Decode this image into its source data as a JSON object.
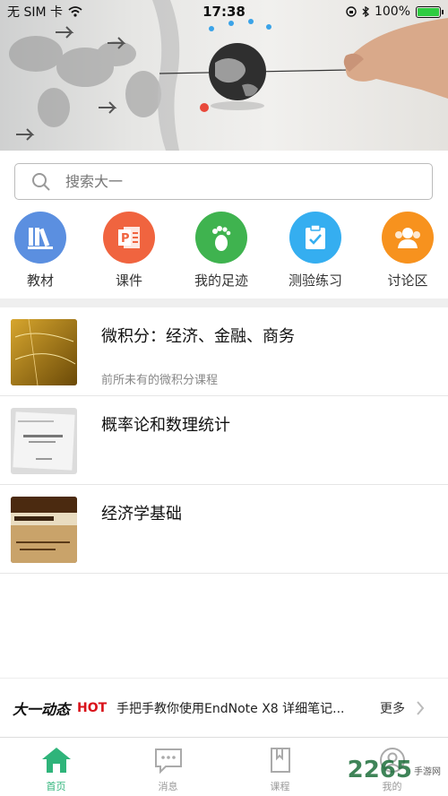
{
  "status_bar": {
    "carrier": "无 SIM 卡",
    "time": "17:38",
    "battery": "100%",
    "battery_level": 1.0
  },
  "search": {
    "placeholder": "搜索大一"
  },
  "quick_nav": [
    {
      "label": "教材",
      "icon": "books-icon",
      "color": "#5b8fe0"
    },
    {
      "label": "课件",
      "icon": "powerpoint-icon",
      "color": "#f0643f"
    },
    {
      "label": "我的足迹",
      "icon": "footprint-icon",
      "color": "#3fb34f"
    },
    {
      "label": "测验练习",
      "icon": "clipboard-check-icon",
      "color": "#35aef0"
    },
    {
      "label": "讨论区",
      "icon": "group-icon",
      "color": "#f7921e"
    }
  ],
  "courses": [
    {
      "title": "微积分：经济、金融、商务",
      "desc": "前所未有的微积分课程"
    },
    {
      "title": "概率论和数理统计",
      "desc": ""
    },
    {
      "title": "经济学基础",
      "desc": ""
    }
  ],
  "ticker": {
    "logo": "大一动态",
    "hot": "HOT",
    "text": "手把手教你使用EndNote X8 详细笔记...",
    "more": "更多"
  },
  "tabs": [
    {
      "label": "首页",
      "icon": "home-icon",
      "active": true
    },
    {
      "label": "消息",
      "icon": "message-icon",
      "active": false
    },
    {
      "label": "课程",
      "icon": "bookmark-book-icon",
      "active": false
    },
    {
      "label": "我的",
      "icon": "user-icon",
      "active": false
    }
  ],
  "watermark": {
    "text": "2265",
    "suffix": "手游网"
  }
}
